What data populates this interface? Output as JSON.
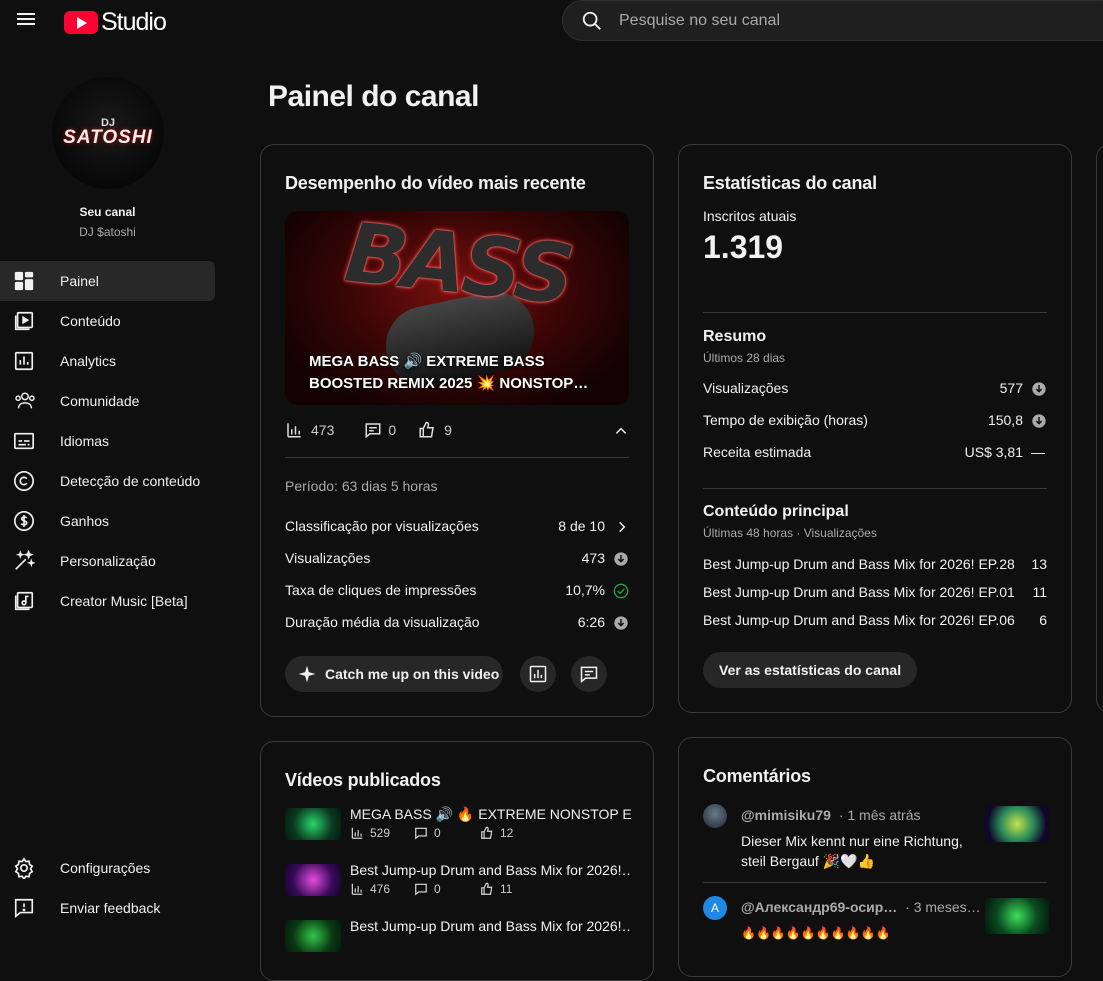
{
  "header": {
    "logo_text": "Studio",
    "search_placeholder": "Pesquise no seu canal"
  },
  "sidebar": {
    "avatar_dj": "DJ",
    "avatar_name": "SATOSHI",
    "channel_label": "Seu canal",
    "channel_name": "DJ $atoshi",
    "items": [
      {
        "label": "Painel",
        "icon": "dashboard-icon",
        "active": true
      },
      {
        "label": "Conteúdo",
        "icon": "content-icon"
      },
      {
        "label": "Analytics",
        "icon": "analytics-icon"
      },
      {
        "label": "Comunidade",
        "icon": "community-icon"
      },
      {
        "label": "Idiomas",
        "icon": "subtitles-icon"
      },
      {
        "label": "Detecção de conteúdo",
        "icon": "copyright-icon"
      },
      {
        "label": "Ganhos",
        "icon": "earn-icon"
      },
      {
        "label": "Personalização",
        "icon": "customize-icon"
      },
      {
        "label": "Creator Music [Beta]",
        "icon": "music-icon"
      }
    ],
    "bottom": [
      {
        "label": "Configurações",
        "icon": "settings-icon"
      },
      {
        "label": "Enviar feedback",
        "icon": "feedback-icon"
      }
    ]
  },
  "page": {
    "title": "Painel do canal"
  },
  "latest_video": {
    "heading": "Desempenho do vídeo mais recente",
    "thumb_text": "BASS",
    "caption": "MEGA BASS 🔊 EXTREME BASS BOOSTED REMIX 2025 💥 NONSTOP…",
    "views": "473",
    "comments": "0",
    "likes": "9",
    "period": "Período: 63 dias 5 horas",
    "rows": [
      {
        "label": "Classificação por visualizações",
        "value": "8 de 10"
      },
      {
        "label": "Visualizações",
        "value": "473"
      },
      {
        "label": "Taxa de cliques de impressões",
        "value": "10,7%"
      },
      {
        "label": "Duração média da visualização",
        "value": "6:26"
      }
    ],
    "catch_up_label": "Catch me up on this video"
  },
  "channel_stats": {
    "heading": "Estatísticas do canal",
    "subs_label": "Inscritos atuais",
    "subs_value": "1.319",
    "summary_title": "Resumo",
    "summary_sub": "Últimos 28 dias",
    "summary_rows": [
      {
        "label": "Visualizações",
        "value": "577"
      },
      {
        "label": "Tempo de exibição (horas)",
        "value": "150,8"
      },
      {
        "label": "Receita estimada",
        "value": "US$ 3,81",
        "trend": "—"
      }
    ],
    "top_title": "Conteúdo principal",
    "top_sub": "Últimas 48 horas · Visualizações",
    "top_rows": [
      {
        "label": "Best Jump-up Drum and Bass Mix for 2026! EP.28",
        "value": "13"
      },
      {
        "label": "Best Jump-up Drum and Bass Mix for 2026! EP.01",
        "value": "11"
      },
      {
        "label": "Best Jump-up Drum and Bass Mix for 2026! EP.06",
        "value": "6"
      }
    ],
    "button_label": "Ver as estatísticas do canal"
  },
  "published": {
    "heading": "Vídeos publicados",
    "items": [
      {
        "title": "MEGA BASS 🔊 🔥 EXTREME NONSTOP E…",
        "views": "529",
        "comments": "0",
        "likes": "12"
      },
      {
        "title": "Best Jump-up Drum and Bass Mix for 2026!…",
        "views": "476",
        "comments": "0",
        "likes": "11"
      },
      {
        "title": "Best Jump-up Drum and Bass Mix for 2026!…",
        "views": "",
        "comments": "",
        "likes": ""
      }
    ]
  },
  "comments": {
    "heading": "Comentários",
    "items": [
      {
        "author": "@mimisiku79",
        "time": "· 1 mês atrás",
        "text": "Dieser Mix kennt nur eine Richtung, steil Bergauf 🎉🤍👍"
      },
      {
        "author": "@Александр69-осир…",
        "time": "· 3 meses…",
        "text": "🔥🔥🔥🔥🔥🔥🔥🔥🔥🔥",
        "avatar_letter": "A"
      }
    ]
  },
  "colors": {
    "bg": "#0f0f0f",
    "card_border": "#3a3a3a",
    "accent_red": "#ff0033",
    "check_green": "#2ba640"
  }
}
